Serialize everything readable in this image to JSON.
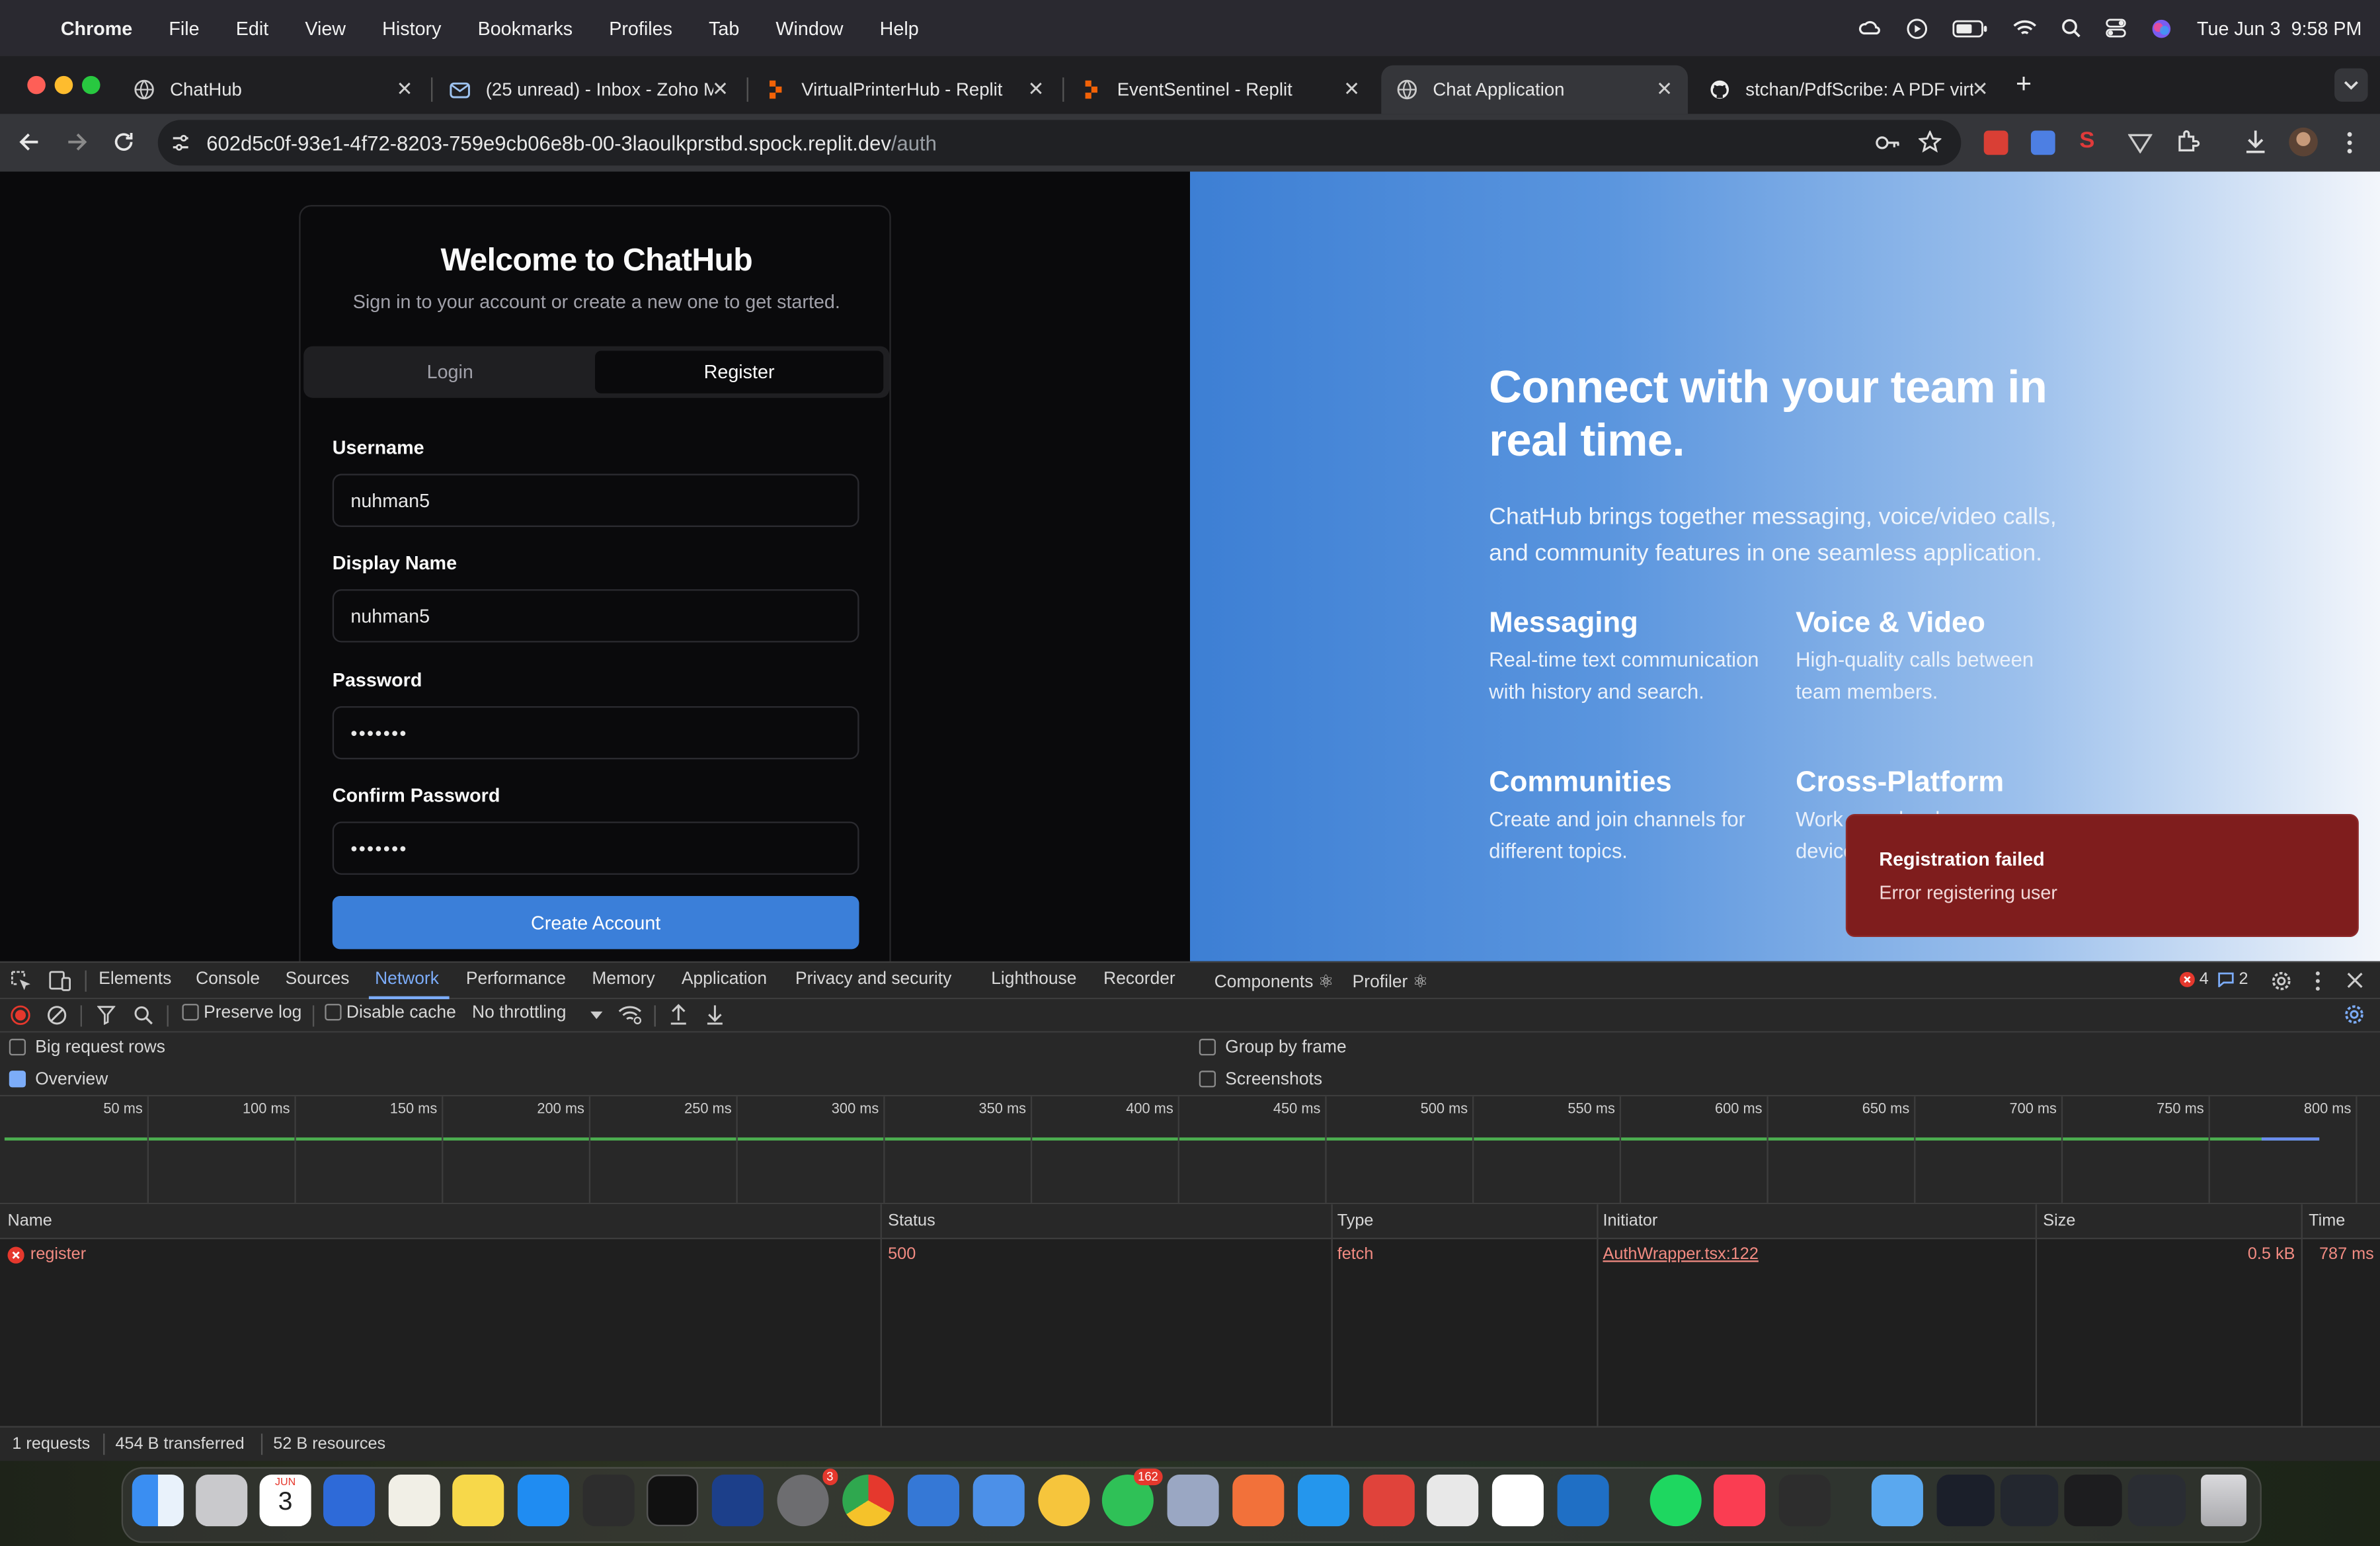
{
  "menubar": {
    "app": "Chrome",
    "items": [
      "File",
      "Edit",
      "View",
      "History",
      "Bookmarks",
      "Profiles",
      "Tab",
      "Window",
      "Help"
    ],
    "datetime": "Tue Jun 3  9:58 PM"
  },
  "tabs": [
    {
      "title": "ChatHub"
    },
    {
      "title": "(25 unread) - Inbox - Zoho M"
    },
    {
      "title": "VirtualPrinterHub - Replit"
    },
    {
      "title": "EventSentinel - Replit"
    },
    {
      "title": "Chat Application"
    },
    {
      "title": "stchan/PdfScribe: A PDF virtu"
    }
  ],
  "url": {
    "host": "602d5c0f-93e1-4f72-8203-759e9cb06e8b-00-3laoulkprstbd.spock.replit.dev",
    "path": "/auth"
  },
  "auth": {
    "title": "Welcome to ChatHub",
    "subtitle": "Sign in to your account or create a new one to get started.",
    "tab_login": "Login",
    "tab_register": "Register",
    "username_label": "Username",
    "username_value": "nuhman5",
    "display_label": "Display Name",
    "display_value": "nuhman5",
    "password_label": "Password",
    "password_value": "•••••••",
    "confirm_label": "Confirm Password",
    "confirm_value": "•••••••",
    "submit": "Create Account"
  },
  "hero": {
    "title": "Connect with your team in real time.",
    "description": "ChatHub brings together messaging, voice/video calls, and community features in one seamless application.",
    "features": [
      {
        "title": "Messaging",
        "text": "Real-time text communication with history and search."
      },
      {
        "title": "Voice & Video",
        "text": "High-quality calls between team members."
      },
      {
        "title": "Communities",
        "text": "Create and join channels for different topics."
      },
      {
        "title": "Cross-Platform",
        "text": "Work seamlessly across devices on mobile."
      }
    ]
  },
  "toast": {
    "title": "Registration failed",
    "message": "Error registering user"
  },
  "devtools": {
    "tabs": [
      "Elements",
      "Console",
      "Sources",
      "Network",
      "Performance",
      "Memory",
      "Application",
      "Privacy and security",
      "Lighthouse",
      "Recorder",
      "Components ⚛",
      "Profiler ⚛"
    ],
    "active_tab": "Network",
    "error_count": "4",
    "message_count": "2",
    "preserve_log": "Preserve log",
    "disable_cache": "Disable cache",
    "throttling": "No throttling",
    "big_rows": "Big request rows",
    "overview": "Overview",
    "group_by_frame": "Group by frame",
    "screenshots": "Screenshots",
    "timeline_ticks": [
      "50 ms",
      "100 ms",
      "150 ms",
      "200 ms",
      "250 ms",
      "300 ms",
      "350 ms",
      "400 ms",
      "450 ms",
      "500 ms",
      "550 ms",
      "600 ms",
      "650 ms",
      "700 ms",
      "750 ms",
      "800 ms"
    ],
    "columns": {
      "name": "Name",
      "status": "Status",
      "type": "Type",
      "initiator": "Initiator",
      "size": "Size",
      "time": "Time"
    },
    "rows": [
      {
        "name": "register",
        "status": "500",
        "type": "fetch",
        "initiator": "AuthWrapper.tsx:122",
        "size": "0.5 kB",
        "time": "787 ms"
      }
    ],
    "status_bar": {
      "requests": "1 requests",
      "transferred": "454 B transferred",
      "resources": "52 B resources"
    }
  },
  "dock": {
    "calendar_month": "JUN",
    "calendar_day": "3",
    "settings_badge": "3",
    "whatsapp_badge": "162"
  },
  "colors": {
    "accent": "#3b7fd9",
    "toast_bg": "#7f1d1d",
    "devtools_active": "#7cacf8",
    "error": "#e5382d"
  }
}
